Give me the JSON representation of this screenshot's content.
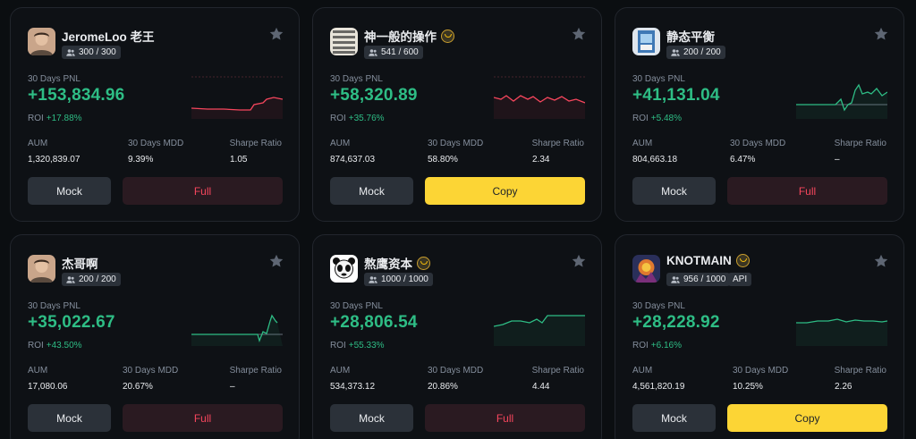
{
  "cards": [
    {
      "name": "JeromeLoo 老王",
      "verified": false,
      "copiers": "300 / 300",
      "api": "",
      "pnl_label": "30 Days PNL",
      "pnl": "+153,834.96",
      "roi_label": "ROI",
      "roi": "+17.88%",
      "aum_label": "AUM",
      "aum": "1,320,839.07",
      "mdd_label": "30 Days MDD",
      "mdd": "9.39%",
      "sharpe_label": "Sharpe Ratio",
      "sharpe": "1.05",
      "mock_label": "Mock",
      "action_label": "Full",
      "action_type": "full",
      "trend": "down",
      "avatar": "person-photo-avatar"
    },
    {
      "name": "神一般的操作",
      "verified": true,
      "copiers": "541 / 600",
      "api": "",
      "pnl_label": "30 Days PNL",
      "pnl": "+58,320.89",
      "roi_label": "ROI",
      "roi": "+35.76%",
      "aum_label": "AUM",
      "aum": "874,637.03",
      "mdd_label": "30 Days MDD",
      "mdd": "58.80%",
      "sharpe_label": "Sharpe Ratio",
      "sharpe": "2.34",
      "mock_label": "Mock",
      "action_label": "Copy",
      "action_type": "copy",
      "trend": "down",
      "avatar": "text-pattern-avatar"
    },
    {
      "name": "静态平衡",
      "verified": false,
      "copiers": "200 / 200",
      "api": "",
      "pnl_label": "30 Days PNL",
      "pnl": "+41,131.04",
      "roi_label": "ROI",
      "roi": "+5.48%",
      "aum_label": "AUM",
      "aum": "804,663.18",
      "mdd_label": "30 Days MDD",
      "mdd": "6.47%",
      "sharpe_label": "Sharpe Ratio",
      "sharpe": "–",
      "mock_label": "Mock",
      "action_label": "Full",
      "action_type": "full",
      "trend": "up",
      "avatar": "card-art-avatar"
    },
    {
      "name": "杰哥啊",
      "verified": false,
      "copiers": "200 / 200",
      "api": "",
      "pnl_label": "30 Days PNL",
      "pnl": "+35,022.67",
      "roi_label": "ROI",
      "roi": "+43.50%",
      "aum_label": "AUM",
      "aum": "17,080.06",
      "mdd_label": "30 Days MDD",
      "mdd": "20.67%",
      "sharpe_label": "Sharpe Ratio",
      "sharpe": "–",
      "mock_label": "Mock",
      "action_label": "Full",
      "action_type": "full",
      "trend": "up",
      "avatar": "person-photo-avatar"
    },
    {
      "name": "熬鹰资本",
      "verified": true,
      "copiers": "1000 / 1000",
      "api": "",
      "pnl_label": "30 Days PNL",
      "pnl": "+28,806.54",
      "roi_label": "ROI",
      "roi": "+55.33%",
      "aum_label": "AUM",
      "aum": "534,373.12",
      "mdd_label": "30 Days MDD",
      "mdd": "20.86%",
      "sharpe_label": "Sharpe Ratio",
      "sharpe": "4.44",
      "mock_label": "Mock",
      "action_label": "Full",
      "action_type": "full",
      "trend": "up",
      "avatar": "panda-avatar"
    },
    {
      "name": "KNOTMAIN",
      "verified": true,
      "copiers": "956 / 1000",
      "api": "API",
      "pnl_label": "30 Days PNL",
      "pnl": "+28,228.92",
      "roi_label": "ROI",
      "roi": "+6.16%",
      "aum_label": "AUM",
      "aum": "4,561,820.19",
      "mdd_label": "30 Days MDD",
      "mdd": "10.25%",
      "sharpe_label": "Sharpe Ratio",
      "sharpe": "2.26",
      "mock_label": "Mock",
      "action_label": "Copy",
      "action_type": "copy",
      "trend": "up",
      "avatar": "artwork-avatar"
    }
  ],
  "colors": {
    "positive": "#2ebd85",
    "negative": "#f6465d",
    "accent": "#fcd535"
  },
  "icons": {
    "favorite": "star-icon",
    "copiers": "users-icon",
    "verified": "medal-badge-icon"
  }
}
